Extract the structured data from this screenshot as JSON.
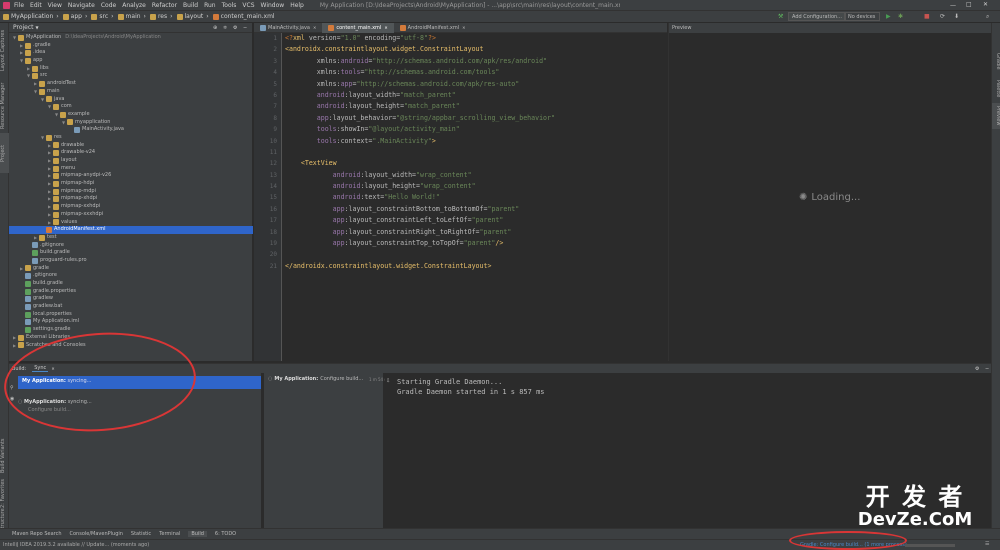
{
  "menubar": {
    "items": [
      "File",
      "Edit",
      "View",
      "Navigate",
      "Code",
      "Analyze",
      "Refactor",
      "Build",
      "Run",
      "Tools",
      "VCS",
      "Window",
      "Help"
    ],
    "title": "My Application [D:\\IdeaProjects\\Android\\MyApplication] - ...\\app\\src\\main\\res\\layout\\content_main.xml - IntelliJ IDEA"
  },
  "navbar": {
    "crumbs": [
      "MyApplication",
      "app",
      "src",
      "main",
      "res",
      "layout",
      "content_main.xml"
    ],
    "add_config": "Add Configuration...",
    "devices": "No devices"
  },
  "project_panel": {
    "title": "Project",
    "tree": [
      {
        "label": "MyApplication",
        "extra": "D:\\IdeaProjects\\Android\\MyApplication",
        "indent": 0,
        "icon": "folder",
        "open": true
      },
      {
        "label": ".gradle",
        "indent": 1,
        "icon": "folder"
      },
      {
        "label": ".idea",
        "indent": 1,
        "icon": "folder"
      },
      {
        "label": "app",
        "indent": 1,
        "icon": "folder",
        "open": true
      },
      {
        "label": "libs",
        "indent": 2,
        "icon": "folder"
      },
      {
        "label": "src",
        "indent": 2,
        "icon": "folder",
        "open": true
      },
      {
        "label": "androidTest",
        "indent": 3,
        "icon": "folder"
      },
      {
        "label": "main",
        "indent": 3,
        "icon": "folder",
        "open": true
      },
      {
        "label": "java",
        "indent": 4,
        "icon": "folder",
        "open": true
      },
      {
        "label": "com",
        "indent": 5,
        "icon": "folder",
        "open": true
      },
      {
        "label": "example",
        "indent": 6,
        "icon": "folder",
        "open": true
      },
      {
        "label": "myapplication",
        "indent": 7,
        "icon": "folder",
        "open": true
      },
      {
        "label": "MainActivity.java",
        "indent": 8,
        "icon": "file"
      },
      {
        "label": "res",
        "indent": 4,
        "icon": "folder",
        "open": true
      },
      {
        "label": "drawable",
        "indent": 5,
        "icon": "folder"
      },
      {
        "label": "drawable-v24",
        "indent": 5,
        "icon": "folder"
      },
      {
        "label": "layout",
        "indent": 5,
        "icon": "folder"
      },
      {
        "label": "menu",
        "indent": 5,
        "icon": "folder"
      },
      {
        "label": "mipmap-anydpi-v26",
        "indent": 5,
        "icon": "folder"
      },
      {
        "label": "mipmap-hdpi",
        "indent": 5,
        "icon": "folder"
      },
      {
        "label": "mipmap-mdpi",
        "indent": 5,
        "icon": "folder"
      },
      {
        "label": "mipmap-xhdpi",
        "indent": 5,
        "icon": "folder"
      },
      {
        "label": "mipmap-xxhdpi",
        "indent": 5,
        "icon": "folder"
      },
      {
        "label": "mipmap-xxxhdpi",
        "indent": 5,
        "icon": "folder"
      },
      {
        "label": "values",
        "indent": 5,
        "icon": "folder"
      },
      {
        "label": "AndroidManifest.xml",
        "indent": 4,
        "icon": "xml",
        "selected": true
      },
      {
        "label": "test",
        "indent": 3,
        "icon": "folder"
      },
      {
        "label": ".gitignore",
        "indent": 2,
        "icon": "file"
      },
      {
        "label": "build.gradle",
        "indent": 2,
        "icon": "gradle"
      },
      {
        "label": "proguard-rules.pro",
        "indent": 2,
        "icon": "file"
      },
      {
        "label": "gradle",
        "indent": 1,
        "icon": "folder"
      },
      {
        "label": ".gitignore",
        "indent": 1,
        "icon": "file"
      },
      {
        "label": "build.gradle",
        "indent": 1,
        "icon": "gradle"
      },
      {
        "label": "gradle.properties",
        "indent": 1,
        "icon": "gradle"
      },
      {
        "label": "gradlew",
        "indent": 1,
        "icon": "file"
      },
      {
        "label": "gradlew.bat",
        "indent": 1,
        "icon": "file"
      },
      {
        "label": "local.properties",
        "indent": 1,
        "icon": "gradle"
      },
      {
        "label": "My Application.iml",
        "indent": 1,
        "icon": "file"
      },
      {
        "label": "settings.gradle",
        "indent": 1,
        "icon": "gradle"
      },
      {
        "label": "External Libraries",
        "indent": 0,
        "icon": "folder"
      },
      {
        "label": "Scratches and Consoles",
        "indent": 0,
        "icon": "folder"
      }
    ]
  },
  "editor": {
    "tabs": [
      "MainActivity.java",
      "content_main.xml",
      "AndroidManifest.xml"
    ],
    "active_tab": 1,
    "line_numbers": [
      "1",
      "2",
      "3",
      "4",
      "5",
      "6",
      "7",
      "8",
      "9",
      "10",
      "11",
      "12",
      "13",
      "14",
      "15",
      "16",
      "17",
      "18",
      "19",
      "20",
      "21"
    ],
    "lines": [
      [
        {
          "c": "kw",
          "t": "<?"
        },
        {
          "c": "tag",
          "t": "xml "
        },
        {
          "c": "attr",
          "t": "version="
        },
        {
          "c": "val",
          "t": "\"1.0\" "
        },
        {
          "c": "attr",
          "t": "encoding="
        },
        {
          "c": "val",
          "t": "\"utf-8\""
        },
        {
          "c": "kw",
          "t": "?>"
        }
      ],
      [
        {
          "c": "tag",
          "t": "<androidx.constraintlayout.widget.ConstraintLayout"
        }
      ],
      [
        {
          "c": "attr",
          "t": "        xmlns:"
        },
        {
          "c": "ns",
          "t": "android"
        },
        {
          "c": "attr",
          "t": "="
        },
        {
          "c": "val",
          "t": "\"http://schemas.android.com/apk/res/android\""
        }
      ],
      [
        {
          "c": "attr",
          "t": "        xmlns:"
        },
        {
          "c": "ns",
          "t": "tools"
        },
        {
          "c": "attr",
          "t": "="
        },
        {
          "c": "val",
          "t": "\"http://schemas.android.com/tools\""
        }
      ],
      [
        {
          "c": "attr",
          "t": "        xmlns:"
        },
        {
          "c": "ns",
          "t": "app"
        },
        {
          "c": "attr",
          "t": "="
        },
        {
          "c": "val",
          "t": "\"http://schemas.android.com/apk/res-auto\""
        }
      ],
      [
        {
          "c": "ns",
          "t": "        android"
        },
        {
          "c": "attr",
          "t": ":layout_width="
        },
        {
          "c": "val",
          "t": "\"match_parent\""
        }
      ],
      [
        {
          "c": "ns",
          "t": "        android"
        },
        {
          "c": "attr",
          "t": ":layout_height="
        },
        {
          "c": "val",
          "t": "\"match_parent\""
        }
      ],
      [
        {
          "c": "ns",
          "t": "        app"
        },
        {
          "c": "attr",
          "t": ":layout_behavior="
        },
        {
          "c": "val",
          "t": "\"@string/appbar_scrolling_view_behavior\""
        }
      ],
      [
        {
          "c": "ns",
          "t": "        tools"
        },
        {
          "c": "attr",
          "t": ":showIn="
        },
        {
          "c": "val",
          "t": "\"@layout/activity_main\""
        }
      ],
      [
        {
          "c": "ns",
          "t": "        tools"
        },
        {
          "c": "attr",
          "t": ":context="
        },
        {
          "c": "val",
          "t": "\".MainActivity\""
        },
        {
          "c": "tag",
          "t": ">"
        }
      ],
      [
        {
          "c": "attr",
          "t": ""
        }
      ],
      [
        {
          "c": "tag",
          "t": "    <TextView"
        }
      ],
      [
        {
          "c": "ns",
          "t": "            android"
        },
        {
          "c": "attr",
          "t": ":layout_width="
        },
        {
          "c": "val",
          "t": "\"wrap_content\""
        }
      ],
      [
        {
          "c": "ns",
          "t": "            android"
        },
        {
          "c": "attr",
          "t": ":layout_height="
        },
        {
          "c": "val",
          "t": "\"wrap_content\""
        }
      ],
      [
        {
          "c": "ns",
          "t": "            android"
        },
        {
          "c": "attr",
          "t": ":text="
        },
        {
          "c": "val",
          "t": "\"Hello World!\""
        }
      ],
      [
        {
          "c": "ns",
          "t": "            app"
        },
        {
          "c": "attr",
          "t": ":layout_constraintBottom_toBottomOf="
        },
        {
          "c": "val",
          "t": "\"parent\""
        }
      ],
      [
        {
          "c": "ns",
          "t": "            app"
        },
        {
          "c": "attr",
          "t": ":layout_constraintLeft_toLeftOf="
        },
        {
          "c": "val",
          "t": "\"parent\""
        }
      ],
      [
        {
          "c": "ns",
          "t": "            app"
        },
        {
          "c": "attr",
          "t": ":layout_constraintRight_toRightOf="
        },
        {
          "c": "val",
          "t": "\"parent\""
        }
      ],
      [
        {
          "c": "ns",
          "t": "            app"
        },
        {
          "c": "attr",
          "t": ":layout_constraintTop_toTopOf="
        },
        {
          "c": "val",
          "t": "\"parent\""
        },
        {
          "c": "tag",
          "t": "/>"
        }
      ],
      [
        {
          "c": "attr",
          "t": ""
        }
      ],
      [
        {
          "c": "tag",
          "t": "</androidx.constraintlayout.widget.ConstraintLayout>"
        }
      ]
    ]
  },
  "preview": {
    "title": "Preview",
    "loading": "Loading..."
  },
  "build": {
    "tabs": [
      "Build:",
      "Sync"
    ],
    "items": [
      {
        "title": "My Application:",
        "status": "syncing...",
        "selected": true
      },
      {
        "title": "MyApplication:",
        "status": "syncing...",
        "sub": "Configure build..."
      }
    ],
    "mid_title": "My Application:",
    "mid_status": "Configure build...",
    "mid_time": "1 m 54 s",
    "output": [
      "Starting Gradle Daemon...",
      "Gradle Daemon started in 1 s 857 ms"
    ]
  },
  "left_strip": [
    "Project",
    "Resource Manager"
  ],
  "left_strip_bottom": [
    "Build Variants",
    "2: Favorites",
    "1: Structure",
    "Layout Captures"
  ],
  "right_strip": [
    "Gradle",
    "Palette",
    "Preview"
  ],
  "bottom_tools": [
    "Maven Repo Search",
    "Console/MavenPlugin",
    "Statistic",
    "Terminal",
    "Build",
    "6: TODO"
  ],
  "status": {
    "left": "IntelliJ IDEA 2019.3.2 available // Update... (moments ago)",
    "right": "Gradle: Configure build... (1 more process)"
  },
  "watermark": {
    "line1": "开 发 者",
    "line2": "DevZe.CoM"
  },
  "colors": {
    "accent": "#2f65ca",
    "annotation": "#d93636"
  }
}
